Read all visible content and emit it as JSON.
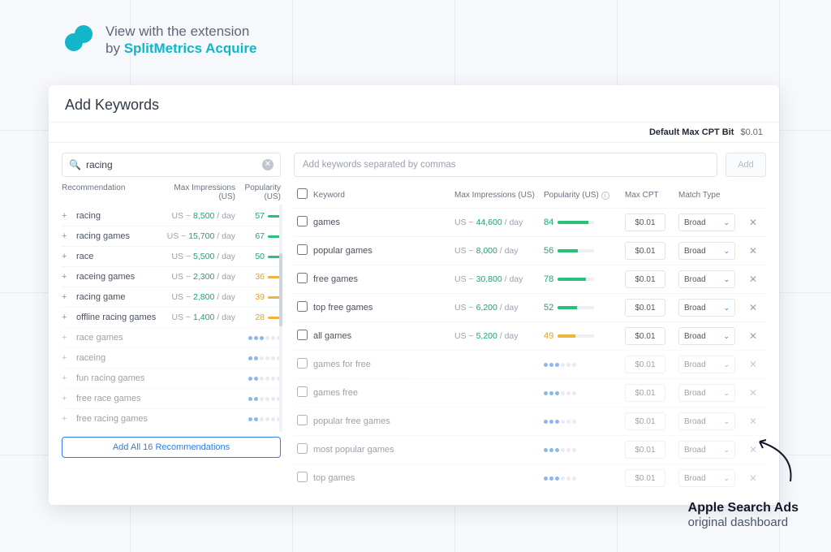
{
  "header": {
    "line1": "View with the extension",
    "line2_prefix": "by ",
    "brand": "SplitMetrics Acquire"
  },
  "panel": {
    "title": "Add Keywords",
    "default_cpt_label": "Default Max CPT Bit",
    "default_cpt_value": "$0.01"
  },
  "search": {
    "value": "racing",
    "placeholder": ""
  },
  "rec_headers": {
    "name": "Recommendation",
    "impressions": "Max Impressions (US)",
    "popularity": "Popularity (US)"
  },
  "recommendations": [
    {
      "kw": "racing",
      "imp_region": "US",
      "imp_num": "8,500",
      "pop": 57,
      "color": "green",
      "detailed": true
    },
    {
      "kw": "racing games",
      "imp_region": "US",
      "imp_num": "15,700",
      "pop": 67,
      "color": "green",
      "detailed": true
    },
    {
      "kw": "race",
      "imp_region": "US",
      "imp_num": "5,500",
      "pop": 50,
      "color": "green",
      "detailed": true
    },
    {
      "kw": "raceing games",
      "imp_region": "US",
      "imp_num": "2,300",
      "pop": 36,
      "color": "amber",
      "detailed": true
    },
    {
      "kw": "racing game",
      "imp_region": "US",
      "imp_num": "2,800",
      "pop": 39,
      "color": "amber",
      "detailed": true
    },
    {
      "kw": "offline racing games",
      "imp_region": "US",
      "imp_num": "1,400",
      "pop": 28,
      "color": "amber",
      "detailed": true
    },
    {
      "kw": "race games",
      "dots": 3,
      "detailed": false
    },
    {
      "kw": "raceing",
      "dots": 2,
      "detailed": false
    },
    {
      "kw": "fun racing games",
      "dots": 2,
      "detailed": false
    },
    {
      "kw": "free race games",
      "dots": 2,
      "detailed": false
    },
    {
      "kw": "free racing games",
      "dots": 2,
      "detailed": false
    }
  ],
  "add_all_button": "Add All 16 Recommendations",
  "add_input_placeholder": "Add keywords separated by commas",
  "add_button": "Add",
  "table_headers": {
    "keyword": "Keyword",
    "impressions": "Max Impressions (US)",
    "popularity": "Popularity (US)",
    "max_cpt": "Max CPT",
    "match_type": "Match Type"
  },
  "keywords": [
    {
      "kw": "games",
      "imp_region": "US",
      "imp_num": "44,600",
      "pop": 84,
      "color": "green",
      "cpt": "$0.01",
      "match": "Broad",
      "detailed": true
    },
    {
      "kw": "popular games",
      "imp_region": "US",
      "imp_num": "8,000",
      "pop": 56,
      "color": "green",
      "cpt": "$0.01",
      "match": "Broad",
      "detailed": true
    },
    {
      "kw": "free games",
      "imp_region": "US",
      "imp_num": "30,800",
      "pop": 78,
      "color": "green",
      "cpt": "$0.01",
      "match": "Broad",
      "detailed": true
    },
    {
      "kw": "top free games",
      "imp_region": "US",
      "imp_num": "6,200",
      "pop": 52,
      "color": "green",
      "cpt": "$0.01",
      "match": "Broad",
      "detailed": true
    },
    {
      "kw": "all games",
      "imp_region": "US",
      "imp_num": "5,200",
      "pop": 49,
      "color": "amber",
      "cpt": "$0.01",
      "match": "Broad",
      "detailed": true
    },
    {
      "kw": "games for free",
      "dots": 3,
      "cpt": "$0.01",
      "match": "Broad",
      "detailed": false
    },
    {
      "kw": "games free",
      "dots": 3,
      "cpt": "$0.01",
      "match": "Broad",
      "detailed": false
    },
    {
      "kw": "popular free games",
      "dots": 3,
      "cpt": "$0.01",
      "match": "Broad",
      "detailed": false
    },
    {
      "kw": "most popular games",
      "dots": 3,
      "cpt": "$0.01",
      "match": "Broad",
      "detailed": false
    },
    {
      "kw": "top games",
      "dots": 3,
      "cpt": "$0.01",
      "match": "Broad",
      "detailed": false
    }
  ],
  "annotation": {
    "line1": "Apple Search Ads",
    "line2": "original dashboard"
  },
  "imp_suffix": " / day",
  "imp_join": " ~ "
}
